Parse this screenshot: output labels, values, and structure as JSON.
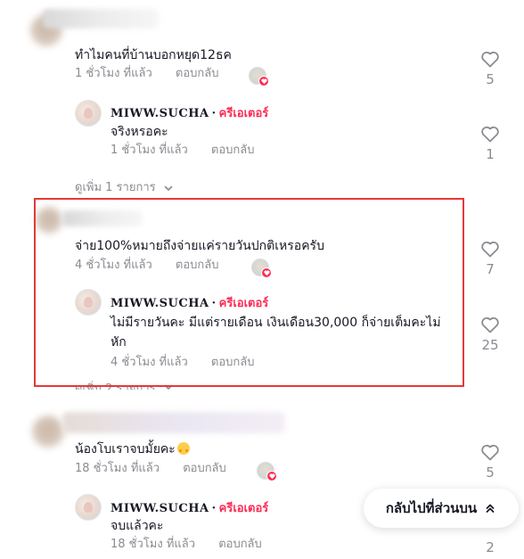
{
  "colors": {
    "accent": "#fe2c55",
    "highlight_border": "#e53935",
    "meta_gray": "#8a8b91"
  },
  "threads": [
    {
      "comment": {
        "text": "ทำไมคนที่บ้านบอกหยุด12ธค",
        "time": "1 ชั่วโมง ที่แล้ว",
        "reply": "ตอบกลับ",
        "likes": "5"
      },
      "reply": {
        "author": "MIWW.SUCHA",
        "separator": "·",
        "badge": "ครีเอเตอร์",
        "text": "จริงหรอคะ",
        "time": "1 ชั่วโมง ที่แล้ว",
        "reply": "ตอบกลับ",
        "likes": "1"
      },
      "view_more": "ดูเพิ่ม 1 รายการ"
    },
    {
      "comment": {
        "text": "จ่าย100%หมายถึงจ่ายแค่รายวันปกติเหรอครับ",
        "time": "4 ชั่วโมง ที่แล้ว",
        "reply": "ตอบกลับ",
        "likes": "7"
      },
      "reply": {
        "author": "MIWW.SUCHA",
        "separator": "·",
        "badge": "ครีเอเตอร์",
        "text_line1": "ไม่มีรายวันคะ มีแต่รายเดือน เงินเดือน30,000 ก็จ่ายเต็มคะไม่",
        "text_line2": "หัก",
        "time": "4 ชั่วโมง ที่แล้ว",
        "reply": "ตอบกลับ",
        "likes": "25"
      },
      "view_more": "ดูเพิ่ม 2 รายการ"
    },
    {
      "comment": {
        "text": "น้องโบเราจบมั้ยคะ",
        "time": "18 ชั่วโมง ที่แล้ว",
        "reply": "ตอบกลับ",
        "likes": "5"
      },
      "reply": {
        "author": "MIWW.SUCHA",
        "separator": "·",
        "badge": "ครีเอเตอร์",
        "text": "จบแล้วคะ",
        "time": "18 ชั่วโมง ที่แล้ว",
        "reply": "ตอบกลับ",
        "likes": "2"
      }
    }
  ],
  "back_to_top": {
    "label": "กลับไปที่ส่วนบน",
    "icon": "double-chevron-up-icon"
  },
  "icons": {
    "like": "heart-outline-icon",
    "expand": "chevron-down-icon"
  }
}
